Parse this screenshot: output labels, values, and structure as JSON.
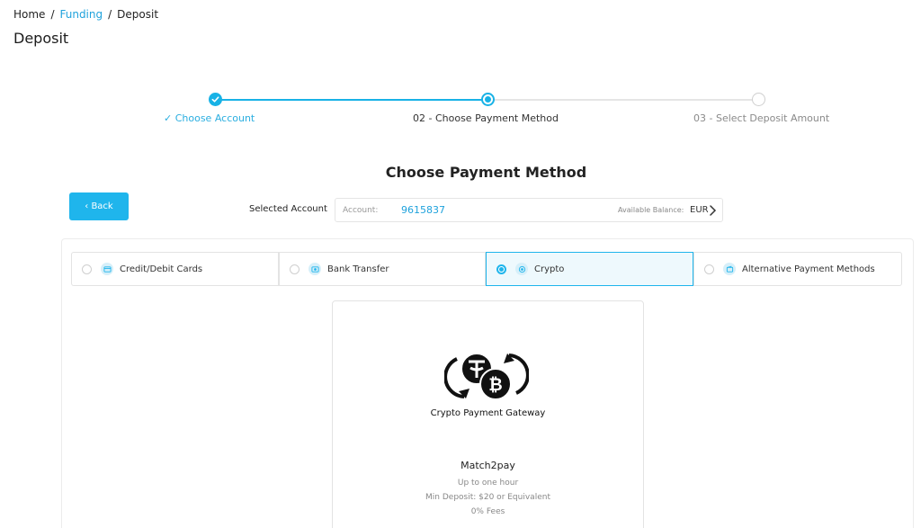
{
  "breadcrumb": {
    "home": "Home",
    "funding": "Funding",
    "current": "Deposit",
    "sep": "/"
  },
  "page_title": "Deposit",
  "stepper": {
    "step1": "✓ Choose Account",
    "step2": "02 - Choose Payment Method",
    "step3": "03 - Select Deposit Amount"
  },
  "section_title": "Choose Payment Method",
  "back_button": "‹ Back",
  "selected_account": {
    "label": "Selected Account",
    "account_label": "Account:",
    "account_number": "9615837",
    "balance_label": "Available Balance:",
    "currency": "EUR"
  },
  "payment_tabs": [
    {
      "label": "Credit/Debit Cards",
      "selected": false
    },
    {
      "label": "Bank Transfer",
      "selected": false
    },
    {
      "label": "Crypto",
      "selected": true
    },
    {
      "label": "Alternative Payment Methods",
      "selected": false
    }
  ],
  "gateway": {
    "logo_text": "Crypto Payment Gateway",
    "name": "Match2pay",
    "time": "Up to one hour",
    "min_deposit": "Min Deposit: $20 or Equivalent",
    "fees": "0% Fees"
  },
  "colors": {
    "accent": "#1fb5ec",
    "link": "#1fa2dc",
    "selected_tab_bg": "#eef9fd"
  }
}
